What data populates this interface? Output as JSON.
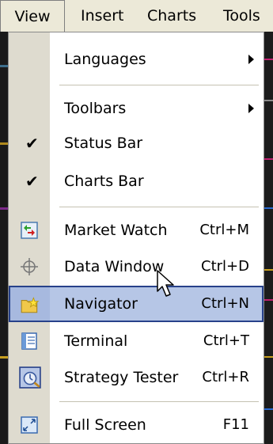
{
  "menubar": {
    "items": [
      {
        "label": "View"
      },
      {
        "label": "Insert"
      },
      {
        "label": "Charts"
      },
      {
        "label": "Tools"
      }
    ]
  },
  "view_menu": {
    "languages": {
      "label": "Languages"
    },
    "toolbars": {
      "label": "Toolbars"
    },
    "status_bar": {
      "label": "Status Bar",
      "checked": true
    },
    "charts_bar": {
      "label": "Charts Bar",
      "checked": true
    },
    "market_watch": {
      "label": "Market Watch",
      "shortcut": "Ctrl+M",
      "icon": "market-watch-icon"
    },
    "data_window": {
      "label": "Data Window",
      "shortcut": "Ctrl+D",
      "icon": "crosshair-icon"
    },
    "navigator": {
      "label": "Navigator",
      "shortcut": "Ctrl+N",
      "icon": "navigator-folder-star-icon",
      "highlighted": true
    },
    "terminal": {
      "label": "Terminal",
      "shortcut": "Ctrl+T",
      "icon": "terminal-icon"
    },
    "strategy_tester": {
      "label": "Strategy Tester",
      "shortcut": "Ctrl+R",
      "icon": "strategy-tester-icon"
    },
    "full_screen": {
      "label": "Full Screen",
      "shortcut": "F11",
      "icon": "full-screen-icon"
    }
  },
  "colors": {
    "menu_bg": "#ffffff",
    "gutter": "#dedbcf",
    "highlight": "#b6c6e6",
    "highlight_border": "#27418a",
    "menubar_bg": "#ece9d8"
  }
}
